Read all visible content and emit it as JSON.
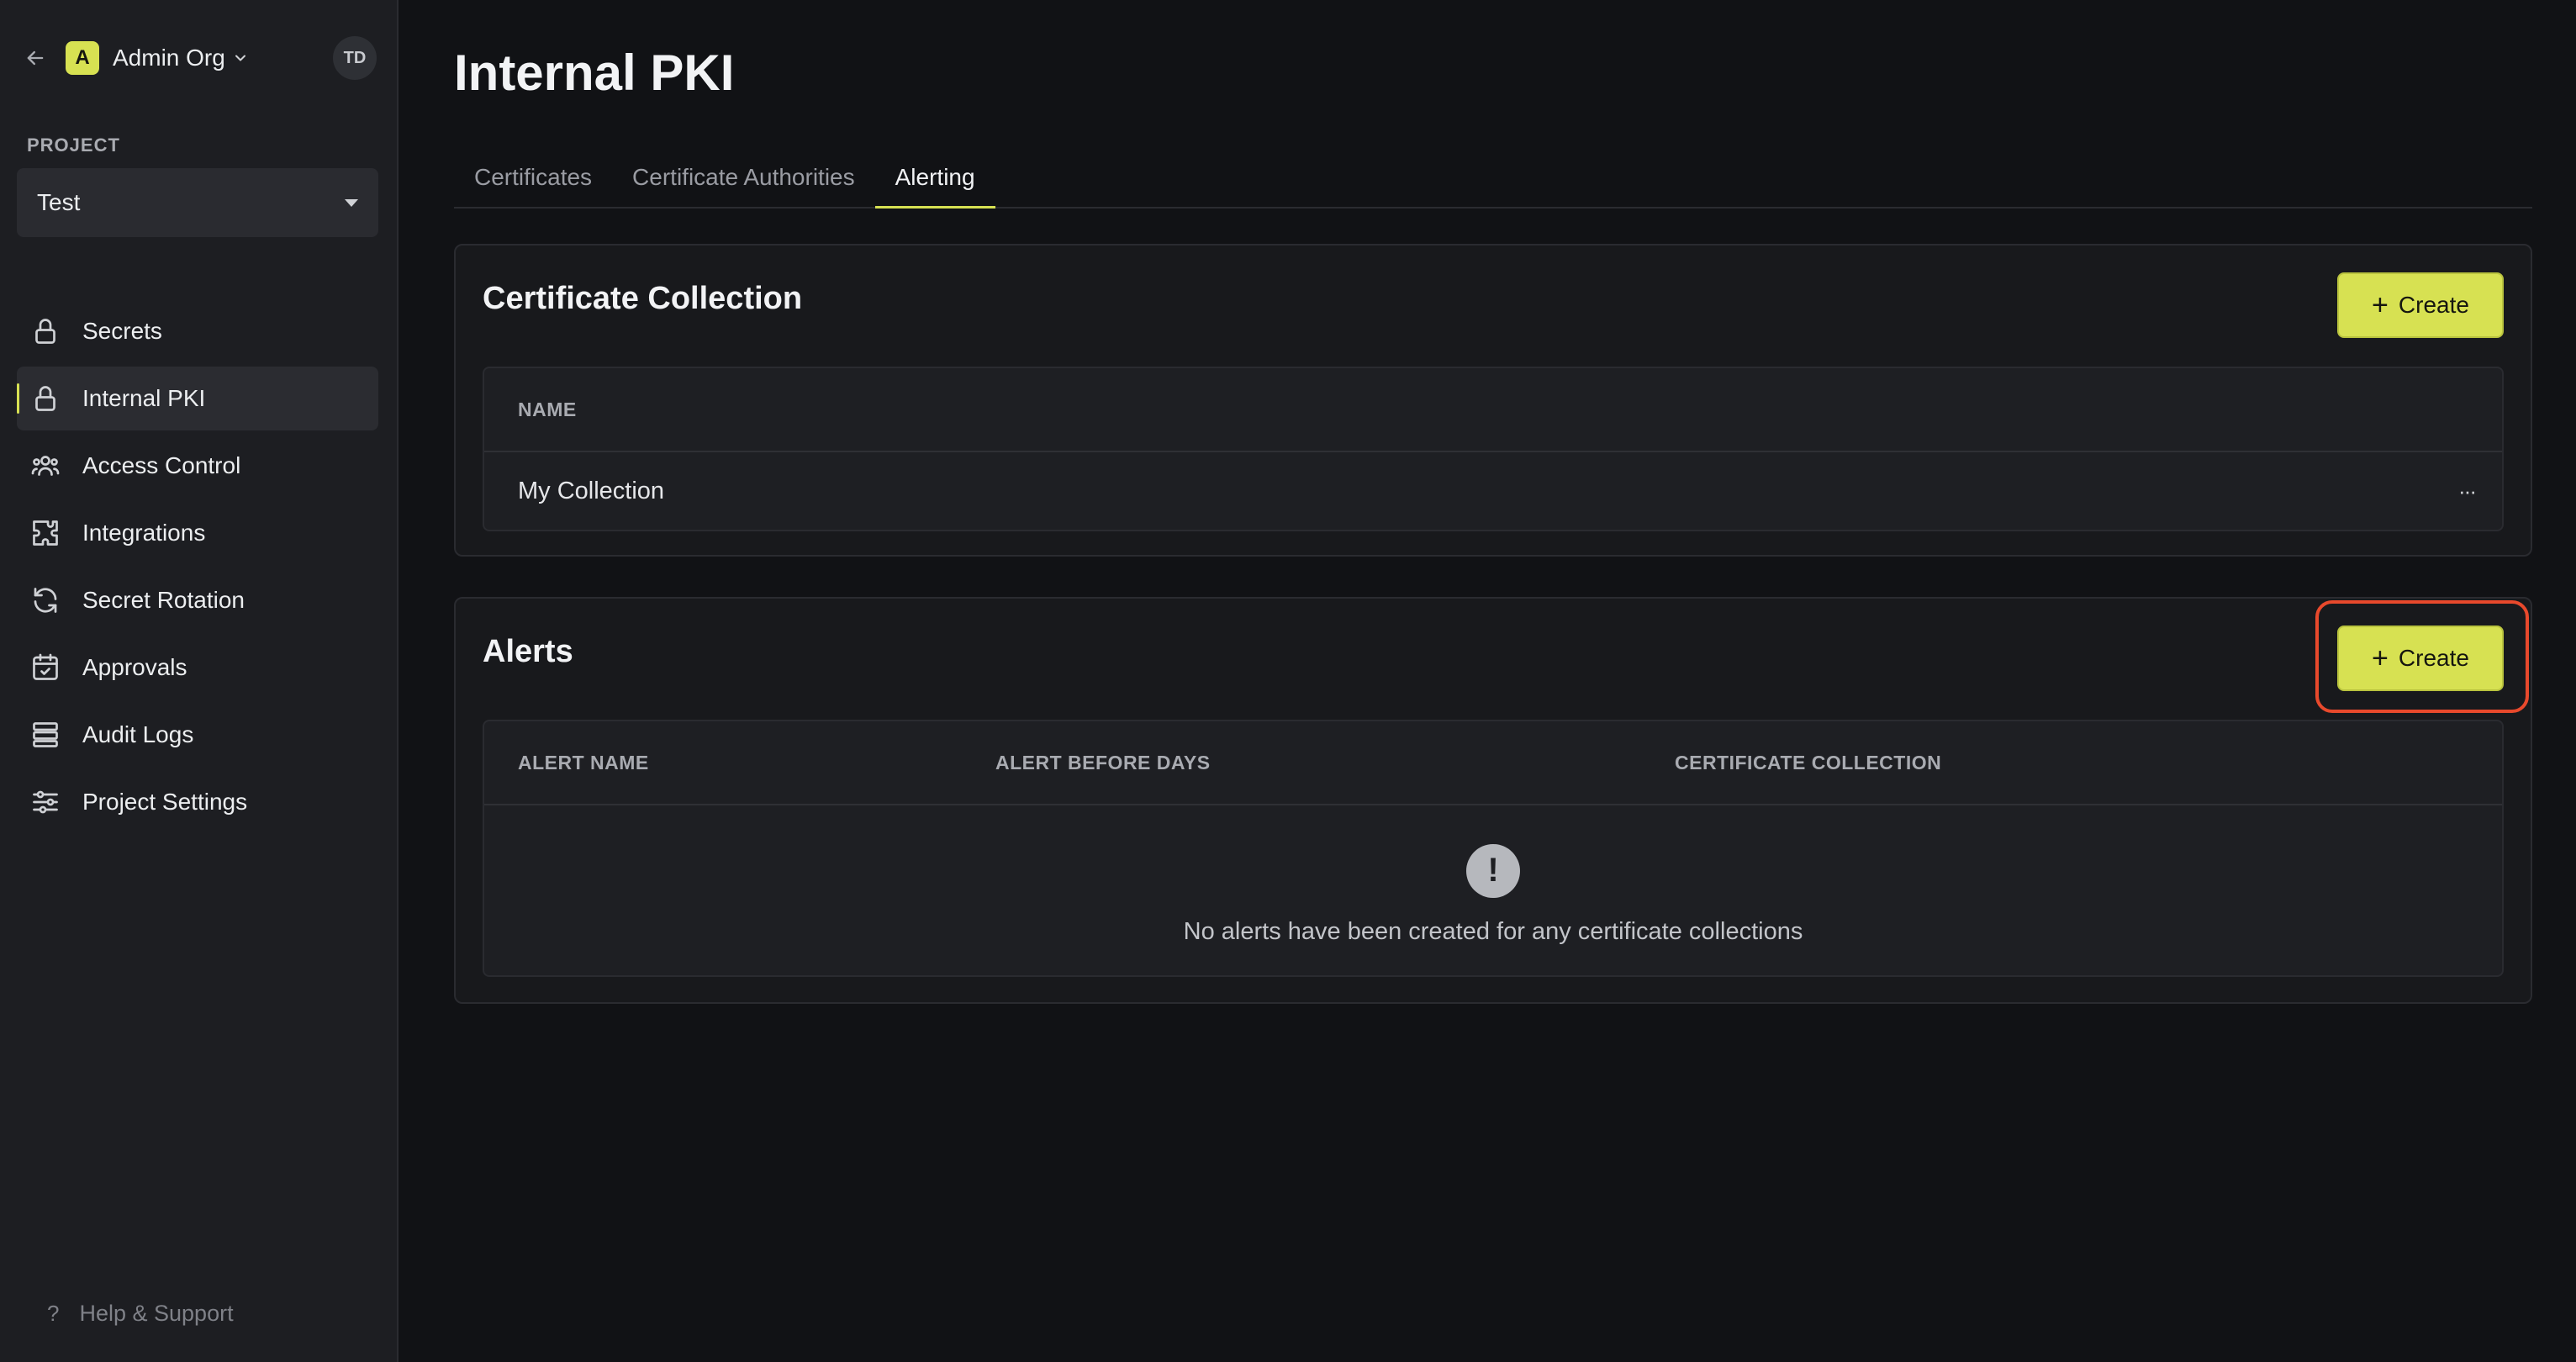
{
  "sidebar": {
    "org_badge": "A",
    "org_name": "Admin Org",
    "avatar_initials": "TD",
    "project_label": "PROJECT",
    "project_selected": "Test",
    "items": [
      {
        "label": "Secrets",
        "icon": "lock-icon"
      },
      {
        "label": "Internal PKI",
        "icon": "lock-icon",
        "active": true
      },
      {
        "label": "Access Control",
        "icon": "users-icon"
      },
      {
        "label": "Integrations",
        "icon": "puzzle-icon"
      },
      {
        "label": "Secret Rotation",
        "icon": "rotate-icon"
      },
      {
        "label": "Approvals",
        "icon": "calendar-check-icon"
      },
      {
        "label": "Audit Logs",
        "icon": "list-icon"
      },
      {
        "label": "Project Settings",
        "icon": "sliders-icon"
      }
    ],
    "help": "Help & Support"
  },
  "page": {
    "title": "Internal PKI",
    "tabs": [
      {
        "label": "Certificates"
      },
      {
        "label": "Certificate Authorities"
      },
      {
        "label": "Alerting",
        "active": true
      }
    ]
  },
  "collection": {
    "title": "Certificate Collection",
    "create_label": "Create",
    "columns": [
      "NAME"
    ],
    "rows": [
      "My Collection"
    ],
    "row_menu": "···"
  },
  "alerts": {
    "title": "Alerts",
    "create_label": "Create",
    "columns": [
      "ALERT NAME",
      "ALERT BEFORE DAYS",
      "CERTIFICATE COLLECTION"
    ],
    "empty_icon": "!",
    "empty_text": "No alerts have been created for any certificate collections"
  },
  "colors": {
    "accent": "#d7e152",
    "highlight": "#e8492c",
    "background": "#111215",
    "sidebar": "#1d1e22"
  }
}
